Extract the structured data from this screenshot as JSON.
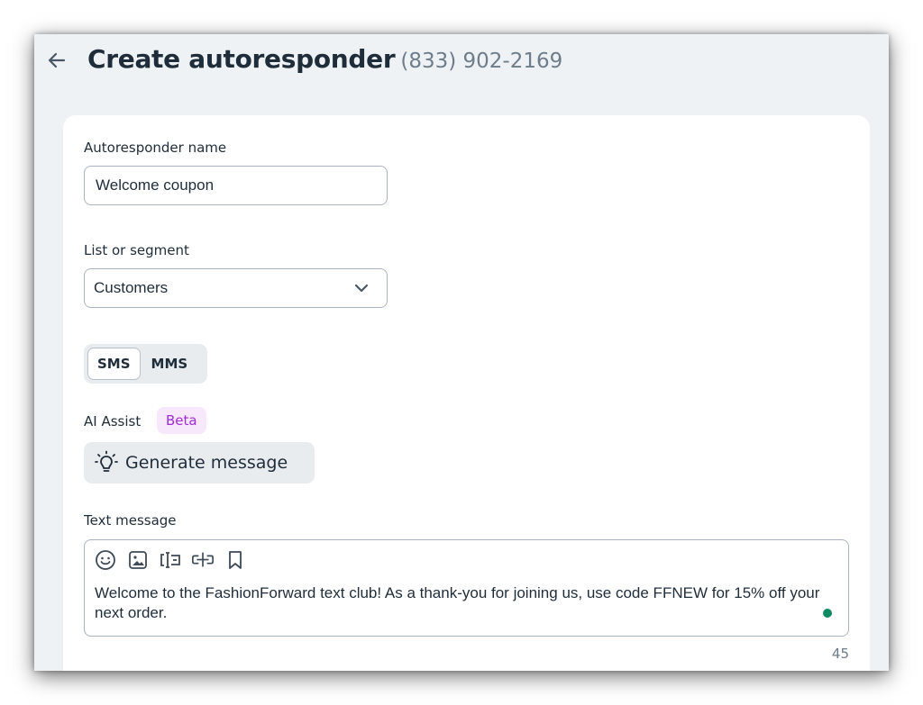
{
  "header": {
    "title": "Create autoresponder",
    "subtitle": "(833) 902-2169"
  },
  "form": {
    "name_label": "Autoresponder name",
    "name_value": "Welcome coupon",
    "list_label": "List or segment",
    "list_value": "Customers",
    "channel_options": [
      "SMS",
      "MMS"
    ],
    "channel_selected": "SMS",
    "ai_label": "AI Assist",
    "ai_badge": "Beta",
    "generate_label": "Generate message",
    "message_label": "Text message",
    "message_text": "Welcome to the FashionForward text club! As a thank-you for joining us, use code FFNEW for 15% off your next order.",
    "char_count": "45"
  },
  "toolbar_icons": [
    "emoji-icon",
    "image-icon",
    "merge-field-icon",
    "link-icon",
    "bookmark-icon"
  ],
  "colors": {
    "beta_text": "#a22bd6",
    "beta_bg": "#f8e8fc",
    "status_dot": "#0f8a63",
    "title": "#1f2d3a",
    "subtitle": "#6e7d8c"
  }
}
